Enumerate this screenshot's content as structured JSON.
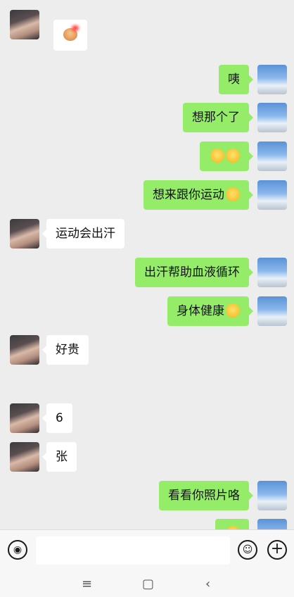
{
  "messages": [
    {
      "side": "left",
      "text": ""
    },
    {
      "side": "right",
      "text": "咦"
    },
    {
      "side": "right",
      "text": "想那个了"
    },
    {
      "side": "right",
      "text": ""
    },
    {
      "side": "right",
      "text": "想来跟你运动"
    },
    {
      "side": "left",
      "text": "运动会出汗"
    },
    {
      "side": "right",
      "text": "出汗帮助血液循环"
    },
    {
      "side": "right",
      "text": "身体健康"
    },
    {
      "side": "left",
      "text": "好贵"
    },
    {
      "side": "left",
      "text": "6"
    },
    {
      "side": "left",
      "text": "张"
    },
    {
      "side": "right",
      "text": "看看你照片咯"
    }
  ],
  "icons": {
    "voice": "voice-icon",
    "emoji": "emoji-icon",
    "plus": "plus-icon"
  },
  "nav": {
    "menu": "≡",
    "home": "▢",
    "back": "‹"
  },
  "colors": {
    "sent_bubble": "#95ec69",
    "received_bubble": "#ffffff",
    "background": "#ededed"
  }
}
